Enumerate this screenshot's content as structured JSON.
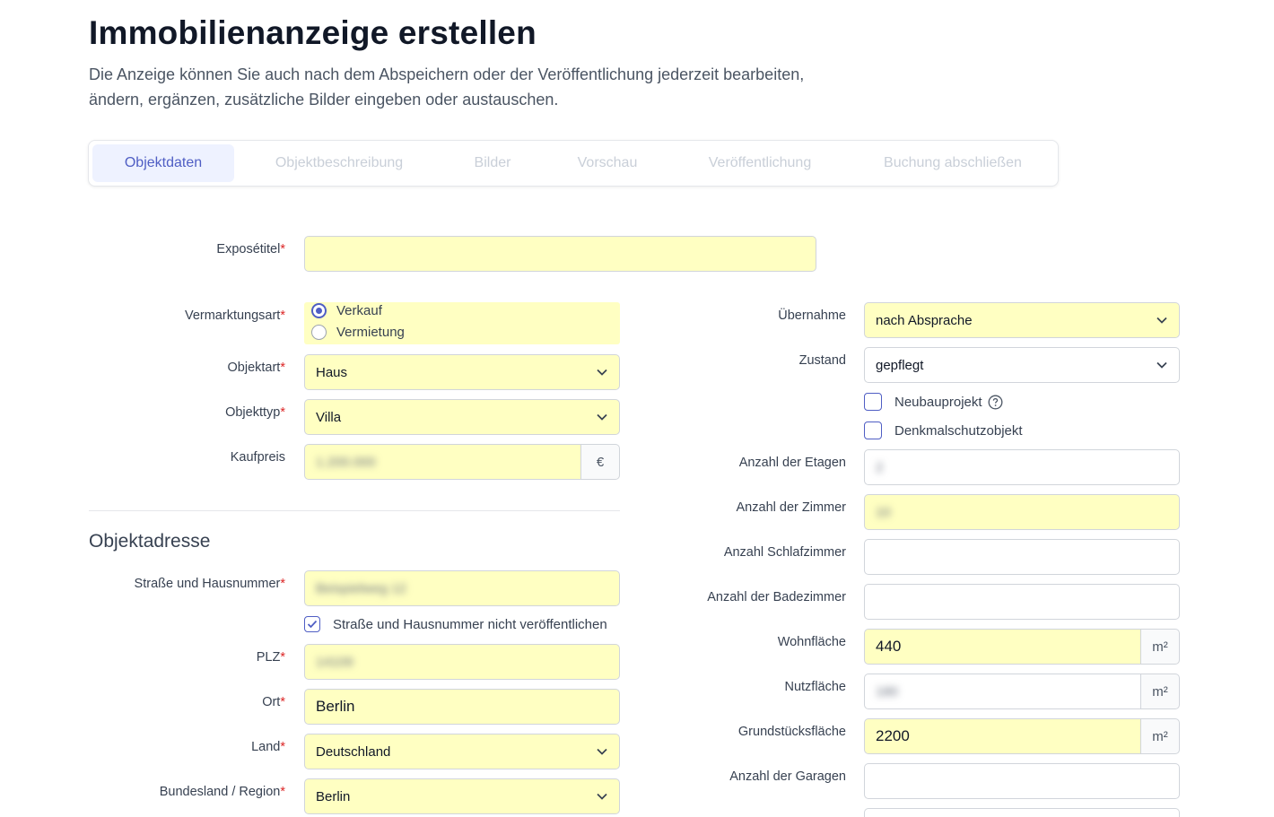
{
  "header": {
    "title": "Immobilienanzeige erstellen",
    "intro": "Die Anzeige können Sie auch nach dem Abspeichern oder der Veröffentlichung jederzeit bearbeiten, ändern, ergänzen, zusätzliche Bilder eingeben oder austauschen."
  },
  "tabs": [
    {
      "label": "Objektdaten",
      "active": true
    },
    {
      "label": "Objektbeschreibung",
      "active": false
    },
    {
      "label": "Bilder",
      "active": false
    },
    {
      "label": "Vorschau",
      "active": false
    },
    {
      "label": "Veröffentlichung",
      "active": false
    },
    {
      "label": "Buchung abschließen",
      "active": false
    }
  ],
  "colors": {
    "accent": "#4f5ec4",
    "highlight": "#ffffc2",
    "required": "#dc2626"
  },
  "form": {
    "expose_title": {
      "label": "Exposétitel",
      "value": ""
    },
    "vermarktungsart": {
      "label": "Vermarktungsart",
      "options": [
        "Verkauf",
        "Vermietung"
      ],
      "selected": "Verkauf"
    },
    "objektart": {
      "label": "Objektart",
      "value": "Haus"
    },
    "objekttyp": {
      "label": "Objekttyp",
      "value": "Villa"
    },
    "kaufpreis": {
      "label": "Kaufpreis",
      "value": "1.200.000",
      "unit": "€"
    },
    "uebernahme": {
      "label": "Übernahme",
      "value": "nach Absprache"
    },
    "zustand": {
      "label": "Zustand",
      "value": "gepflegt"
    },
    "neubauprojekt": {
      "label": "Neubauprojekt",
      "checked": false
    },
    "denkmalschutz": {
      "label": "Denkmalschutzobjekt",
      "checked": false
    },
    "etagen": {
      "label": "Anzahl der Etagen",
      "value": "2"
    },
    "zimmer": {
      "label": "Anzahl der Zimmer",
      "value": "10"
    },
    "schlafzimmer": {
      "label": "Anzahl Schlafzimmer",
      "value": ""
    },
    "badezimmer": {
      "label": "Anzahl der Badezimmer",
      "value": ""
    },
    "wohnflaeche": {
      "label": "Wohnfläche",
      "value": "440",
      "unit": "m²"
    },
    "nutzflaeche": {
      "label": "Nutzfläche",
      "value": "180",
      "unit": "m²"
    },
    "grundstueck": {
      "label": "Grundstücksfläche",
      "value": "2200",
      "unit": "m²"
    },
    "garagen": {
      "label": "Anzahl der Garagen",
      "value": ""
    }
  },
  "address": {
    "heading": "Objektadresse",
    "street": {
      "label": "Straße und Hausnummer",
      "value": "Beispielweg 12"
    },
    "hide_street": {
      "label": "Straße und Hausnummer nicht veröffentlichen",
      "checked": true
    },
    "plz": {
      "label": "PLZ",
      "value": "14109"
    },
    "ort": {
      "label": "Ort",
      "value": "Berlin"
    },
    "land": {
      "label": "Land",
      "value": "Deutschland"
    },
    "region": {
      "label": "Bundesland / Region",
      "value": "Berlin"
    }
  },
  "required_mark": "*",
  "icons": {
    "dropdown": "chevron-down-icon",
    "help": "help-circle-icon",
    "check": "checkmark-icon"
  }
}
